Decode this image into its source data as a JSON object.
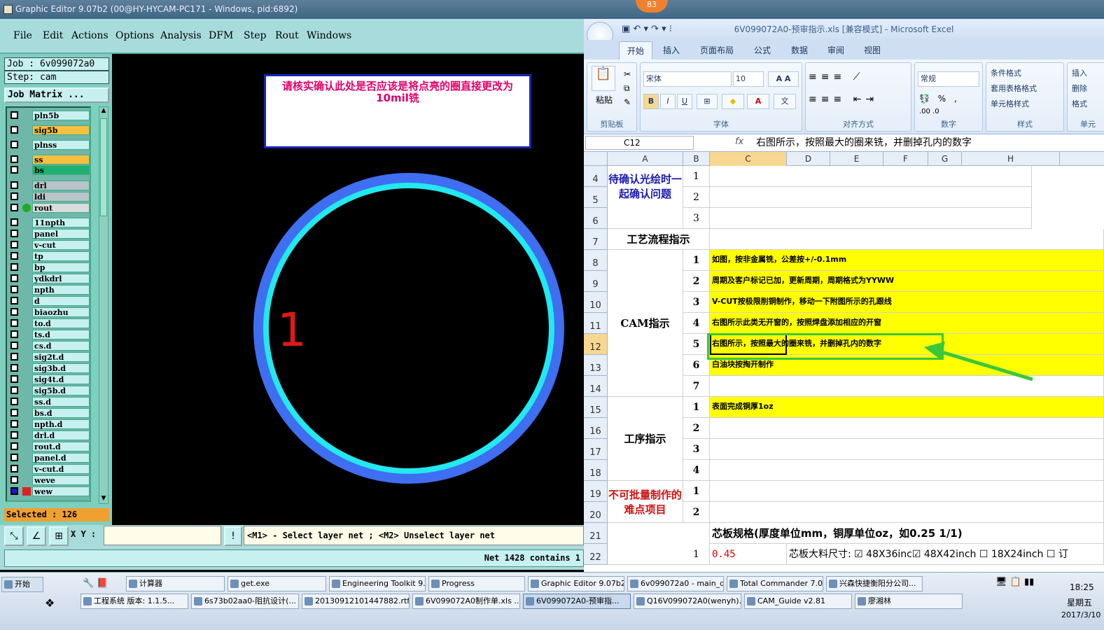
{
  "ge": {
    "title": "Graphic Editor 9.07b2 (00@HY-HYCAM-PC171 - Windows, pid:6892)",
    "badge": "83",
    "menu": [
      "File",
      "Edit",
      "Actions",
      "Options",
      "Analysis",
      "DFM",
      "Step",
      "Rout",
      "Windows"
    ],
    "job": "Job : 6v099072a0",
    "step": "Step: cam",
    "job_matrix": "Job Matrix ...",
    "layers": [
      {
        "name": "pln5b",
        "color": "#c7f0f0"
      },
      {
        "name": "sig5b",
        "color": "#f5c040"
      },
      {
        "name": "plnss",
        "color": "#c7f0f0"
      },
      {
        "name": "ss",
        "color": "#f5c040"
      },
      {
        "name": "bs",
        "color": "#20b070"
      },
      {
        "name": "drl",
        "color": "#b8c4c8"
      },
      {
        "name": "ldi",
        "color": "#b8c4c8"
      },
      {
        "name": "rout",
        "color": "#d8dcdc"
      },
      {
        "name": "11npth",
        "color": "#c7f0f0"
      },
      {
        "name": "panel",
        "color": "#c7f0f0"
      },
      {
        "name": "v-cut",
        "color": "#c7f0f0"
      },
      {
        "name": "tp",
        "color": "#c7f0f0"
      },
      {
        "name": "bp",
        "color": "#c7f0f0"
      },
      {
        "name": "ydkdrl",
        "color": "#c7f0f0"
      },
      {
        "name": "npth",
        "color": "#c7f0f0"
      },
      {
        "name": "d",
        "color": "#c7f0f0"
      },
      {
        "name": "biaozhu",
        "color": "#c7f0f0"
      },
      {
        "name": "to.d",
        "color": "#c7f0f0"
      },
      {
        "name": "ts.d",
        "color": "#c7f0f0"
      },
      {
        "name": "cs.d",
        "color": "#c7f0f0"
      },
      {
        "name": "sig2t.d",
        "color": "#c7f0f0"
      },
      {
        "name": "sig3b.d",
        "color": "#c7f0f0"
      },
      {
        "name": "sig4t.d",
        "color": "#c7f0f0"
      },
      {
        "name": "sig5b.d",
        "color": "#c7f0f0"
      },
      {
        "name": "ss.d",
        "color": "#c7f0f0"
      },
      {
        "name": "bs.d",
        "color": "#c7f0f0"
      },
      {
        "name": "npth.d",
        "color": "#c7f0f0"
      },
      {
        "name": "drl.d",
        "color": "#c7f0f0"
      },
      {
        "name": "rout.d",
        "color": "#c7f0f0"
      },
      {
        "name": "panel.d",
        "color": "#c7f0f0"
      },
      {
        "name": "v-cut.d",
        "color": "#c7f0f0"
      },
      {
        "name": "weve",
        "color": "#c7f0f0"
      },
      {
        "name": "wew",
        "color": "#c7f0f0"
      }
    ],
    "selected": "Selected : 126",
    "note": "请核实确认此处是否应该是将点亮的圈直接更改为10mil铣",
    "canvas_label": "1",
    "xy_label": "X Y :",
    "hint": "<M1> - Select layer net ; <M2> Unselect layer net",
    "status": "Net 1428 contains 1"
  },
  "xl": {
    "title": "6V099072A0-预审指示.xls  [兼容模式] - Microsoft Excel",
    "tabs": [
      "开始",
      "插入",
      "页面布局",
      "公式",
      "数据",
      "审阅",
      "视图"
    ],
    "groups": {
      "clipboard": "剪贴板",
      "font": "字体",
      "align": "对齐方式",
      "number": "数字",
      "styles": "样式",
      "cells": "单元"
    },
    "paste": "粘贴",
    "font_name": "宋体",
    "font_size": "10",
    "number_format": "常规",
    "style_buttons": [
      "条件格式",
      "套用表格格式",
      "单元格样式"
    ],
    "cell_buttons": [
      "插入",
      "删除",
      "格式"
    ],
    "name_box": "C12",
    "formula": "右图所示，按照最大的圈来铣，并删掉孔内的数字",
    "columns": [
      "A",
      "B",
      "C",
      "D",
      "E",
      "F",
      "G",
      "H"
    ],
    "rows": [
      "4",
      "5",
      "6",
      "7",
      "8",
      "9",
      "10",
      "11",
      "12",
      "13",
      "14",
      "15",
      "16",
      "17",
      "18",
      "19",
      "20",
      "21",
      "22"
    ],
    "section_pending": "待确认光绘时一起确认问题",
    "section_process": "工艺流程指示",
    "section_cam": "CAM指示",
    "section_procedure": "工序指示",
    "section_hard": "不可批量制作的难点项目",
    "pending_nums": [
      "1",
      "2",
      "3"
    ],
    "cam_nums": [
      "1",
      "2",
      "3",
      "4",
      "5",
      "6",
      "7"
    ],
    "cam_items": [
      "如图，按非金属铣，公差按+/-0.1mm",
      "周期及客户标记已加，更新周期，周期格式为YYWW",
      "V-CUT按极限削铜制作，移动一下附图所示的孔跟线",
      "右图所示此类无开窗的，按照焊盘添加相应的开窗",
      "右图所示，按照最大的圈来铣，并删掉孔内的数字",
      "白油块按掏开制作",
      ""
    ],
    "proc_nums": [
      "1",
      "2",
      "3",
      "4"
    ],
    "proc_items": [
      "表面完成铜厚1oz",
      "",
      "",
      ""
    ],
    "hard_nums": [
      "1",
      "2"
    ],
    "core_spec": "芯板规格(厚度单位mm，铜厚单位oz，如0.25 1/1)",
    "row22_num": "1",
    "row22_val": "0.45",
    "core_size": "芯板大料尺寸: ☑ 48X36inc☑ 48X42inch ☐ 18X24inch ☐ 订"
  },
  "taskbar": {
    "start": "开始",
    "row1": [
      "计算器",
      "get.exe",
      "Engineering Toolkit 9....",
      "Progress",
      "Graphic Editor 9.07b2 ...",
      "6v099072a0 - main_qa",
      "Total Commander 7.0 ...",
      "兴森快捷衡阳分公司..."
    ],
    "row2": [
      "工程系统  版本: 1.1.5...",
      "6s73b02aa0-阻抗设计(...",
      "20130912101447882.rtf...",
      "6V099072A0制作单.xls ...",
      "6V099072A0-预审指...",
      "Q16V099072A0(wenyh)...",
      "CAM_Guide v2.81",
      "廖湘林"
    ],
    "time": "18:25",
    "weekday": "星期五",
    "date": "2017/3/10"
  },
  "colors": {
    "highlight_green": "#3ac83a",
    "ge_bg": "#a8dcdc",
    "excel_yellow": "#ffff00"
  }
}
